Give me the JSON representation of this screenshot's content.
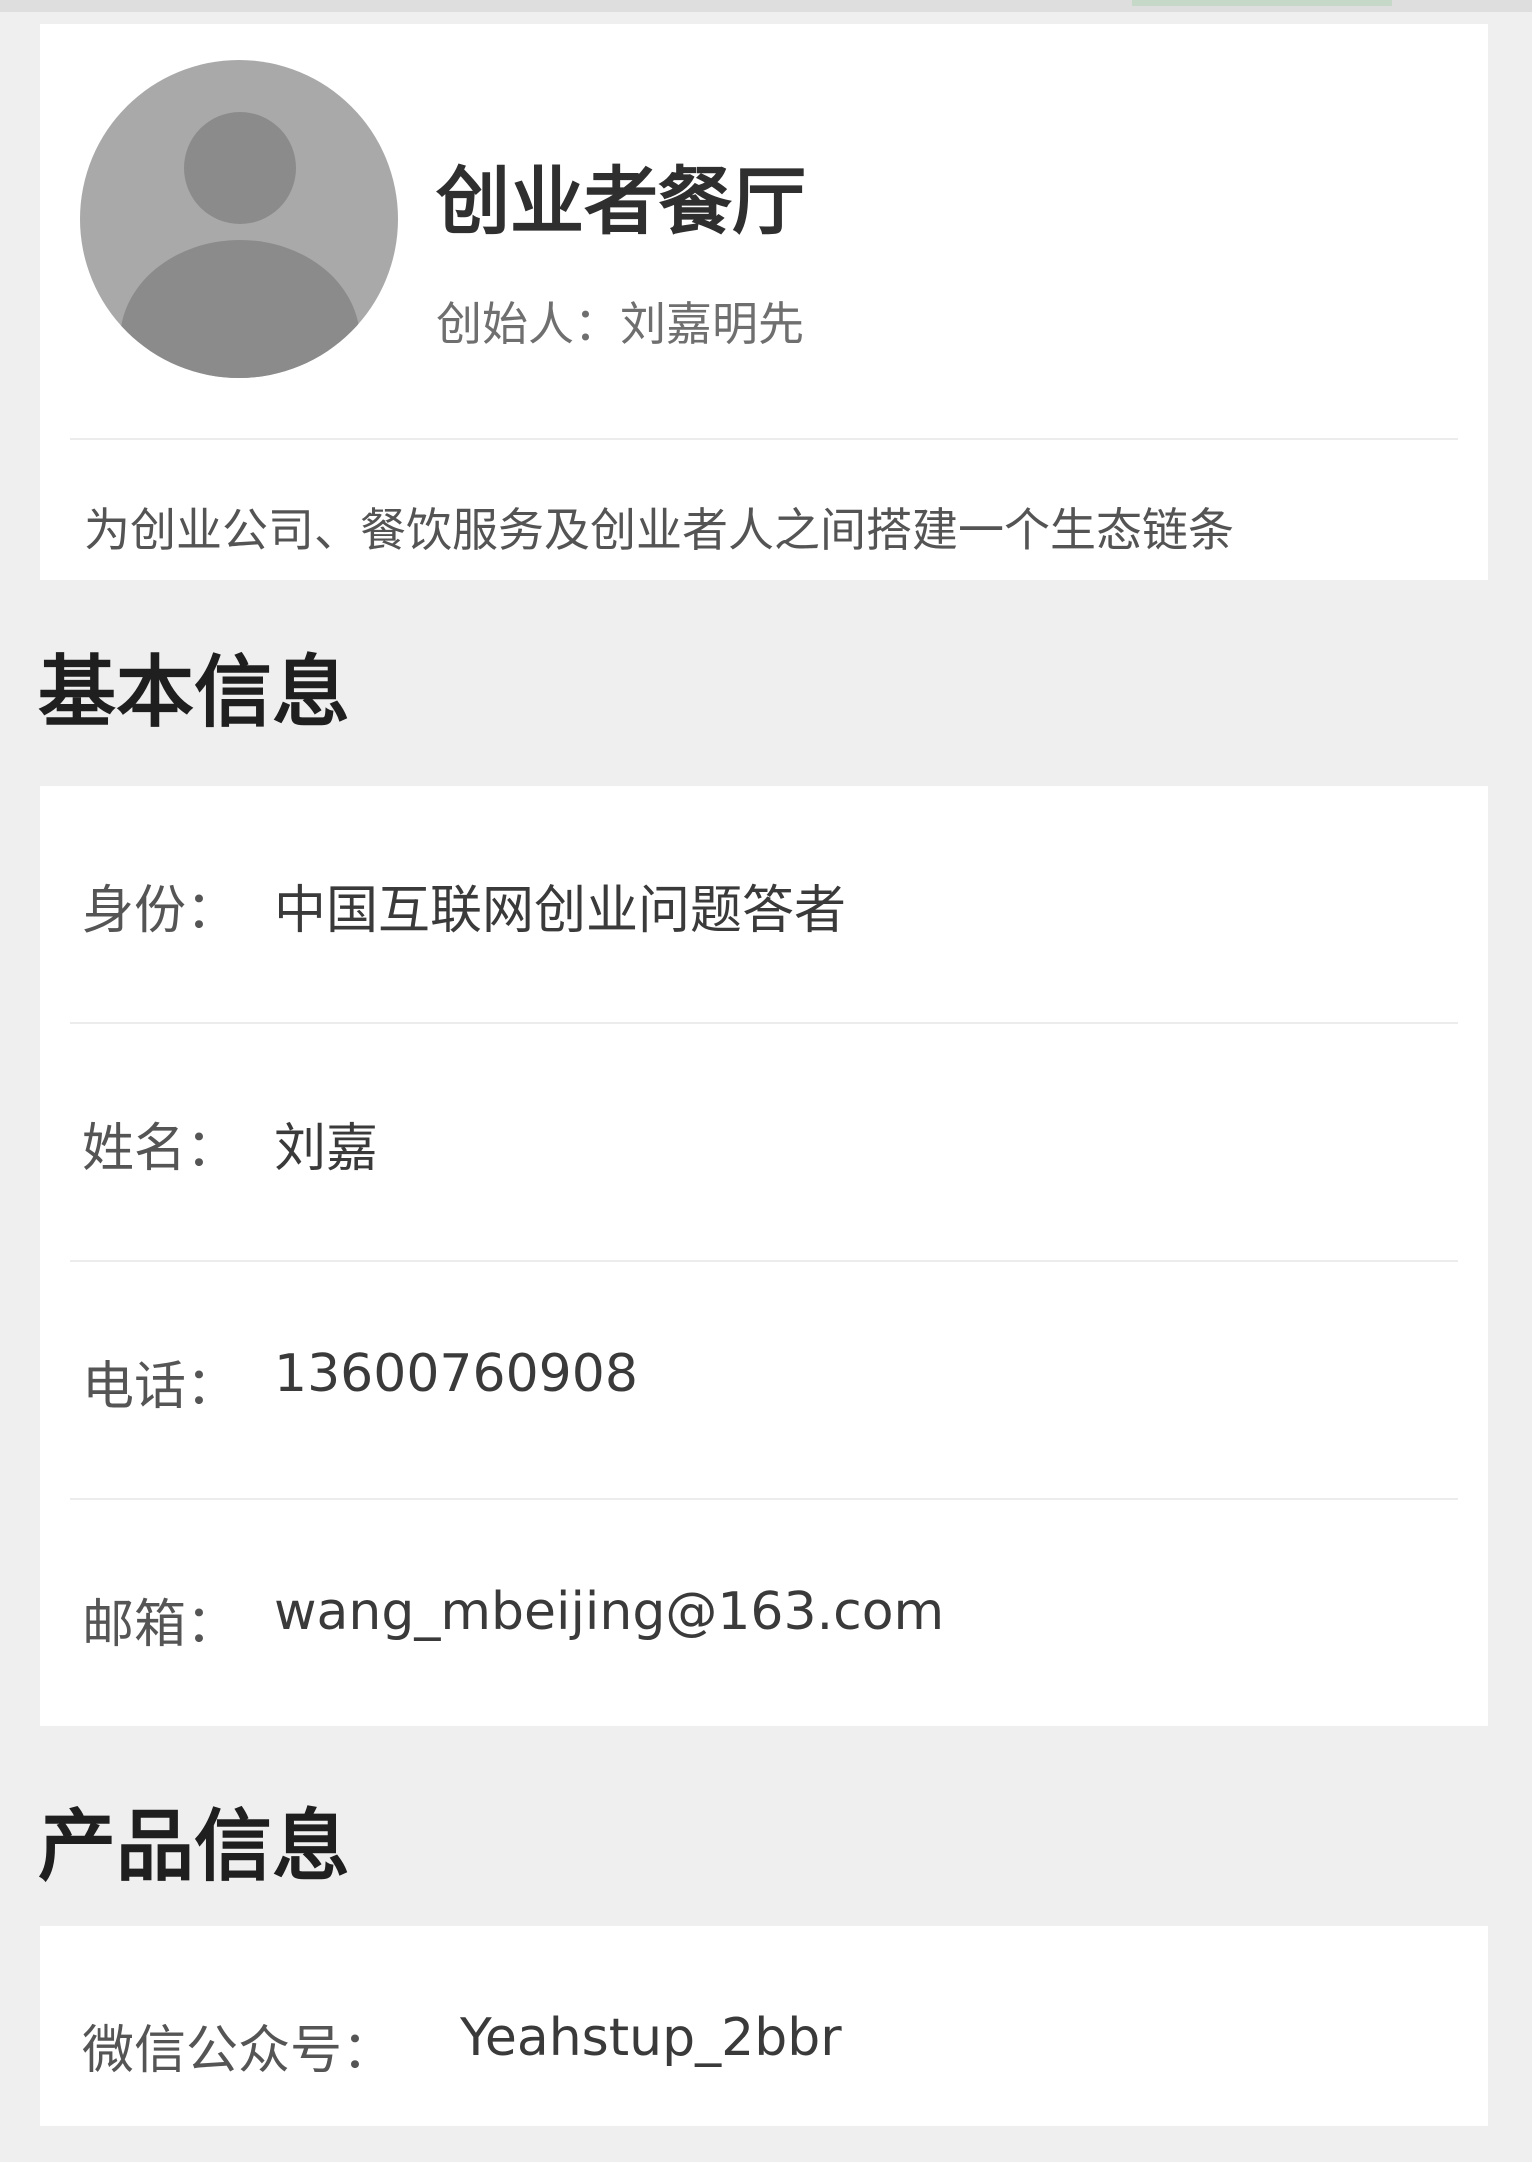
{
  "profile": {
    "company_name": "创业者餐厅",
    "founder_line": "创始人：刘嘉明先",
    "tagline": "为创业公司、餐饮服务及创业者人之间搭建一个生态链条"
  },
  "basic_info": {
    "title": "基本信息",
    "rows": [
      {
        "label": "身份：",
        "value": "中国互联网创业问题答者"
      },
      {
        "label": "姓名：",
        "value": "刘嘉"
      },
      {
        "label": "电话：",
        "value": "13600760908"
      },
      {
        "label": "邮箱：",
        "value": "wang_mbeijing@163.com"
      }
    ]
  },
  "product_info": {
    "title": "产品信息",
    "rows": [
      {
        "label": "微信公众号：",
        "value": "Yeahstup_2bbr"
      }
    ]
  },
  "colors": {
    "page_background": "#efefef",
    "card_background": "#ffffff",
    "avatar_placeholder": "#a9a9a9"
  }
}
